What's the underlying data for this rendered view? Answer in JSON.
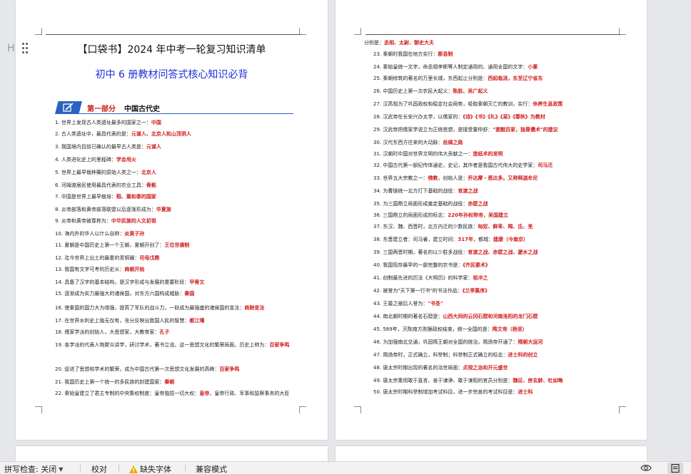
{
  "left_page": {
    "title": "【口袋书】2024 年中考一轮复习知识清单",
    "subtitle": "初中 6 册教材问答式核心知识必背",
    "section_label": "第一部分",
    "section_name": "中国古代史",
    "items": [
      {
        "q": "1. 世界上发现古人类遗址最多的国家之一：",
        "a": "中国"
      },
      {
        "q": "2. 古人类遗址中，最具代表的是：",
        "a": "元谋人、北京人和山顶洞人"
      },
      {
        "q": "3. 我国境内目前已确认的最早古人类是：",
        "a": "元谋人"
      },
      {
        "q": "4. 人类进化史上的里程碑：",
        "a": "学会用火"
      },
      {
        "q": "5. 世界上最早栽种粟的原始人类之一：",
        "a": "北京人"
      },
      {
        "q": "6. 河姆渡居民使用最具代表的农业工具：",
        "a": "骨耜"
      },
      {
        "q": "7. 中国是世界上最早栽培：",
        "a": "稻、粟和黍的国家"
      },
      {
        "q": "8. 炎帝部落和黄帝部落联盟以后逐渐形成为：",
        "a": "华夏族"
      },
      {
        "q": "9. 炎帝和黄帝被尊称为：",
        "a": "中华民族的人文初祖"
      },
      {
        "q": "10. 海内外的华人以什么自称：",
        "a": "炎黄子孙"
      },
      {
        "q": "11. 夏朝是中国历史上第一个王朝，夏朝开创了：",
        "a": "王位世袭制"
      },
      {
        "q": "12. 迄今世界上出土的最重的青铜器：",
        "a": "司母戊鼎"
      },
      {
        "q": "13. 我国有文字可考的历史从：",
        "a": "商朝开始"
      },
      {
        "q": "14. 具备了汉字的基本结构，是汉字形成与发展的重要阶段：",
        "a": "甲骨文"
      },
      {
        "q": "15. 逐渐成为实力最强大的诸侯国，对东方六国构成威胁：",
        "a": "秦国"
      },
      {
        "q": "16. 使秦国的国力大为增强，提高了军队的战斗力，一跃成为最强盛的诸侯国的变法：",
        "a": "商鞅变法"
      },
      {
        "q": "17. 在世界水利史上独无仅有，充分反映出我国人民的智慧：",
        "a": "都江堰"
      },
      {
        "q": "18. 儒家学派的创始人，大思想家，大教育家：",
        "a": "孔子"
      },
      {
        "q": "19. 各学派的代表人物聚众讲学，研讨学术，著书立说。这一思想文化的繁荣局面，历史上称为：",
        "a": "百家争鸣"
      },
      {
        "q": "20. 促进了思想和学术的繁荣，成为中国古代第一次思想文化发展的高峰：",
        "a": "百家争鸣"
      },
      {
        "q": "21. 我国历史上第一个统一的多民族的封建国家：",
        "a": "秦朝"
      },
      {
        "q": "22. 秦始皇建立了君主专制的中央集权制度：皇帝独揽一切大权：",
        "a": "皇帝",
        "extra": "，皇帝行政、军事和监察事务的大臣"
      }
    ]
  },
  "right_page": {
    "lead": {
      "q": "分别是：",
      "a": "丞相、太尉、御史大夫"
    },
    "items": [
      {
        "q": "23. 秦朝时我国在地方实行：",
        "a": "郡县制"
      },
      {
        "q": "24. 秦始皇统一文字，命丞相李斯等人制定通用的、通用全国的文字：",
        "a": "小篆"
      },
      {
        "q": "25. 秦朝修筑的著名的万里长城，东西起止分别是：",
        "a": "西起临洮，东至辽宁省东"
      },
      {
        "q": "26. 中国历史上第一次农民大起义：",
        "a": "陈胜、吴广起义"
      },
      {
        "q": "27. 汉高祖为了巩固政权和稳定社会局势，吸取秦朝灭亡的教训，实行：",
        "a": "休养生息政策"
      },
      {
        "q": "28. 汉武帝在长安兴办太学，以儒家的：",
        "a": "《诗》《书》《礼》《易》《春秋》为教材"
      },
      {
        "q": "29. 汉武帝把儒家学说立为正统思想，是接受董仲舒：",
        "a": "\"罢黜百家，独尊儒术\"的建议"
      },
      {
        "q": "30. 汉代东西方往来的大动脉：",
        "a": "丝绸之路"
      },
      {
        "q": "31. 汉朝时中国对世界文明的伟大贡献之一：",
        "a": "造纸术的发明"
      },
      {
        "q": "32. 中国古代第一部纪传体通史，史记，其作者是我国古代伟大的史学家：",
        "a": "司马迁"
      },
      {
        "q": "33. 世界五大宗教之一：",
        "a": "佛教",
        "mid": "，创始人是：",
        "a2": "乔达摩・悉达多。又称释迦牟尼"
      },
      {
        "q": "34. 为曹操统一北方打下基础的战役：",
        "a": "官渡之战"
      },
      {
        "q": "35. 为三国鼎立局面形成奠定基础的战役：",
        "a": "赤壁之战"
      },
      {
        "q": "36. 三国鼎立的局面形成的标志：",
        "a": "220年孙权称帝，吴国建立"
      },
      {
        "q": "37. 东汉、魏、西晋时，北方内迁的少数民族：",
        "a": "匈奴、鲜卑、羯、氐、羌"
      },
      {
        "q": "38. 东晋建立者：司马睿，建立时间：",
        "a": "317年",
        "mid": "，都城：",
        "a2": "建康（今南京）"
      },
      {
        "q": "39. 三国两晋时期，著名的以少胜多战役：",
        "a": "官渡之战、赤壁之战、淝水之战"
      },
      {
        "q": "40. 我国现存最早的一部完整的农书是：",
        "a": "《齐民要术》"
      },
      {
        "q": "41. 创制最先进的历法《大明历》的科学家：",
        "a": "祖冲之"
      },
      {
        "q": "42. 被誉为\"天下第一行书\"的书法作品：",
        "a": "《兰亭集序》"
      },
      {
        "q": "43. 王羲之被后人誉为：",
        "a": "\"书圣\""
      },
      {
        "q": "44. 南北朝时期的著名石窟是：",
        "a": "山西大同的云冈石窟和河南洛阳的龙门石窟"
      },
      {
        "q": "45. 589年，灭陈南方割据政权结束，统一全国的是：",
        "a": "隋文帝（杨坚）"
      },
      {
        "q": "46. 为加强南北交通，巩固隋王朝对全国的统治，隋炀帝开通了：",
        "a": "隋朝大运河"
      },
      {
        "q": "47. 隋炀帝时，正式确立，科举制；科举制正式确立的标志：",
        "a": "进士科的创立"
      },
      {
        "q": "48. 唐太宗时期出现的著名的治世局面：",
        "a": "贞观之治和开元盛世"
      },
      {
        "q": "49. 唐太宗重用敢于直言、善于谏诤、敢于谏阻的官员分别是：",
        "a": "魏征、房玄龄、杜如晦"
      },
      {
        "q": "50. 唐太宗时期科举制增加考试科目，进一步完善的考试科目是：",
        "a": "进士科"
      }
    ]
  },
  "statusbar": {
    "spellcheck": "拼写检查: 关闭",
    "proofread": "校对",
    "missing_fonts": "缺失字体",
    "compat_mode": "兼容模式"
  },
  "margin_marker": "H",
  "colors": {
    "accent": "#2a63c2",
    "answer": "#d21b1b",
    "subtitle": "#1c2fd8"
  }
}
